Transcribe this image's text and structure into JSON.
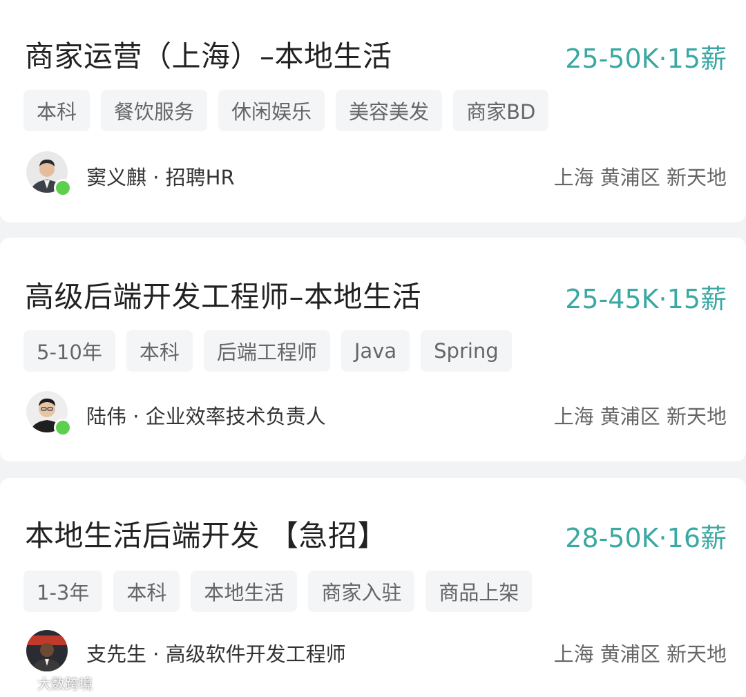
{
  "jobs": [
    {
      "title": "商家运营（上海）–本地生活",
      "salary": "25-50K·15薪",
      "tags": [
        "本科",
        "餐饮服务",
        "休闲娱乐",
        "美容美发",
        "商家BD"
      ],
      "recruiter": "窦义麒 · 招聘HR",
      "location": "上海 黄浦区 新天地",
      "online": true
    },
    {
      "title": "高级后端开发工程师–本地生活",
      "salary": "25-45K·15薪",
      "tags": [
        "5-10年",
        "本科",
        "后端工程师",
        "Java",
        "Spring"
      ],
      "recruiter": "陆伟 · 企业效率技术负责人",
      "location": "上海 黄浦区 新天地",
      "online": true
    },
    {
      "title": "本地生活后端开发 【急招】",
      "salary": "28-50K·16薪",
      "tags": [
        "1-3年",
        "本科",
        "本地生活",
        "商家入驻",
        "商品上架"
      ],
      "recruiter": "支先生 · 高级软件开发工程师",
      "location": "上海 黄浦区 新天地",
      "online": false
    }
  ],
  "watermark": "大数跨境",
  "colors": {
    "salary": "#3aa8a3",
    "online": "#5ccf4f",
    "tag_bg": "#f4f5f7",
    "background": "#f2f3f5"
  }
}
